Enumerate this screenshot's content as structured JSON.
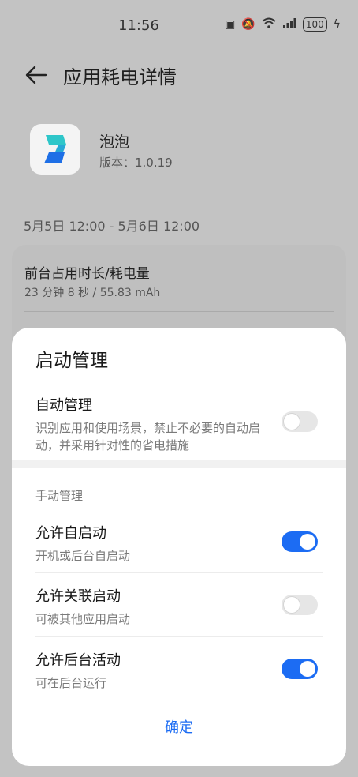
{
  "status_bar": {
    "time": "11:56",
    "battery": "100"
  },
  "header": {
    "title": "应用耗电详情"
  },
  "app": {
    "name": "泡泡",
    "version": "版本：1.0.19"
  },
  "date_range": "5月5日 12:00 - 5月6日 12:00",
  "stats": {
    "label": "前台占用时长/耗电量",
    "value": "23 分钟 8 秒 / 55.83 mAh"
  },
  "sheet": {
    "title": "启动管理",
    "auto": {
      "title": "自动管理",
      "desc": "识别应用和使用场景，禁止不必要的自动启动，并采用针对性的省电措施",
      "enabled": false
    },
    "manual_label": "手动管理",
    "items": [
      {
        "title": "允许自启动",
        "desc": "开机或后台自启动",
        "enabled": true
      },
      {
        "title": "允许关联启动",
        "desc": "可被其他应用启动",
        "enabled": false
      },
      {
        "title": "允许后台活动",
        "desc": "可在后台运行",
        "enabled": true
      }
    ],
    "confirm": "确定"
  },
  "colors": {
    "accent": "#1c6cf3",
    "app_icon_teal": "#2ec6c9",
    "app_icon_blue": "#1e6fe6"
  }
}
